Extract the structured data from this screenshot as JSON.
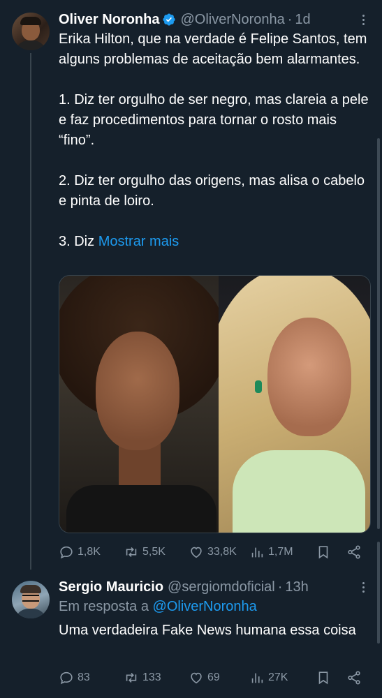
{
  "tweet": {
    "author_name": "Oliver Noronha",
    "handle": "@OliverNoronha",
    "separator": "·",
    "time": "1d",
    "text_lines": [
      "Erika Hilton, que na verdade é Felipe Santos, tem alguns problemas de aceitação bem alarmantes.",
      "1. Diz ter orgulho de ser negro, mas clareia a pele e faz procedimentos para tornar o rosto mais “fino”.",
      "2. Diz ter orgulho das origens, mas alisa o cabelo e pinta de loiro."
    ],
    "truncated_prefix": "3. Diz ",
    "show_more": "Mostrar mais",
    "stats": {
      "replies": "1,8K",
      "retweets": "5,5K",
      "likes": "33,8K",
      "views": "1,7M"
    }
  },
  "reply": {
    "author_name": "Sergio Mauricio",
    "handle": "@sergiomdoficial",
    "separator": "·",
    "time": "13h",
    "reply_prefix": "Em resposta a ",
    "reply_mention": "@OliverNoronha",
    "text": "Uma verdadeira Fake News humana essa coisa",
    "stats": {
      "replies": "83",
      "retweets": "133",
      "likes": "69",
      "views": "27K"
    }
  },
  "icons": {
    "verified": "verified-badge-icon",
    "more": "more-options-icon",
    "reply": "reply-icon",
    "retweet": "retweet-icon",
    "like": "heart-icon",
    "views": "views-icon",
    "bookmark": "bookmark-icon",
    "share": "share-icon"
  },
  "colors": {
    "background": "#15202b",
    "text": "#ffffff",
    "muted": "#8b98a5",
    "accent": "#1d9bf0",
    "divider": "#38444d"
  }
}
